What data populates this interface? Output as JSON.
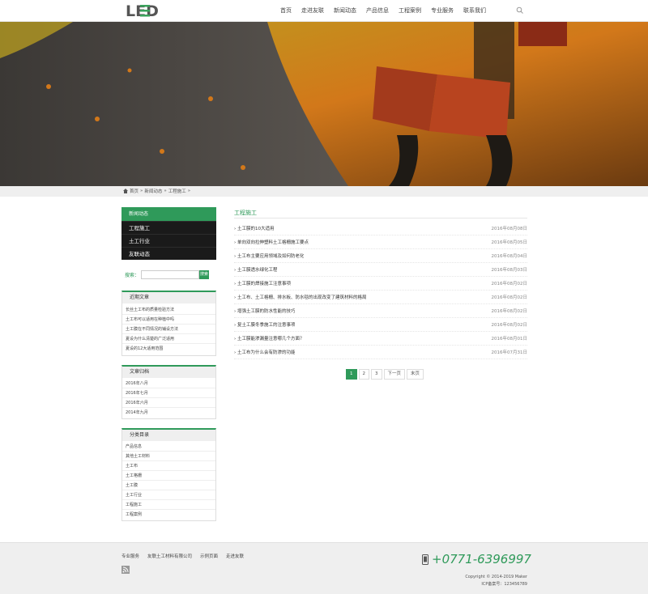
{
  "header": {
    "logo_text": "LED",
    "nav": [
      "首页",
      "走进友联",
      "新闻动态",
      "产品信息",
      "工程案例",
      "专业服务",
      "联系我们"
    ]
  },
  "breadcrumb": [
    "首页",
    "新闻动态",
    "工程施工"
  ],
  "sidebar": {
    "nav_head": "新闻动态",
    "nav_items": [
      "工程施工",
      "土工行业",
      "友联动态"
    ],
    "search_label": "搜索：",
    "search_button": "搜索",
    "recent": {
      "title": "近期文章",
      "items": [
        "长丝土工布的质量检验方法",
        "土工布可以适用在种植中吗",
        "土工膜在不同情况的铺设方法",
        "夏设为什么清楚的广泛适用",
        "夏设的12大适用范围"
      ]
    },
    "archives": {
      "title": "文章归档",
      "items": [
        "2016年八月",
        "2016年七月",
        "2016年六月",
        "2014年九月"
      ]
    },
    "categories": {
      "title": "分类目录",
      "items": [
        "产品信息",
        "其他土工材料",
        "土工布",
        "土工格栅",
        "土工膜",
        "土工行业",
        "工程施工",
        "工程案例"
      ]
    }
  },
  "main": {
    "title": "工程施工",
    "posts": [
      {
        "title": "土工膜的10大适用",
        "date": "2016年08月08日"
      },
      {
        "title": "单向双向拉伸塑料土工格栅施工要点",
        "date": "2016年08月05日"
      },
      {
        "title": "土工布主要应用领域及如何防老化",
        "date": "2016年08月04日"
      },
      {
        "title": "土工膜透水绿化工程",
        "date": "2016年08月03日"
      },
      {
        "title": "土工膜的焊接施工注意事项",
        "date": "2016年08月02日"
      },
      {
        "title": "土工布、土工格栅、排水板、防水毯的出现改变了建筑材料的格局",
        "date": "2016年08月02日"
      },
      {
        "title": "增强土工膜的防水性能的技巧",
        "date": "2016年08月02日"
      },
      {
        "title": "复土工膜冬季施工的注意事项",
        "date": "2016年08月02日"
      },
      {
        "title": "土工膜能渗漏量注意哪几个方面？",
        "date": "2016年08月01日"
      },
      {
        "title": "土工布为什么会有防渗的功能",
        "date": "2016年07月31日"
      }
    ],
    "pager": [
      "1",
      "2",
      "3",
      "下一页",
      "末页"
    ]
  },
  "footer": {
    "links": [
      "专业服务",
      "友联土工材料有限公司",
      "示例页面",
      "走进友联"
    ],
    "phone": "+0771-6396997",
    "copyright": "Copyright © 2014-2019 Maker",
    "icp": "ICP备案号：123456789"
  }
}
